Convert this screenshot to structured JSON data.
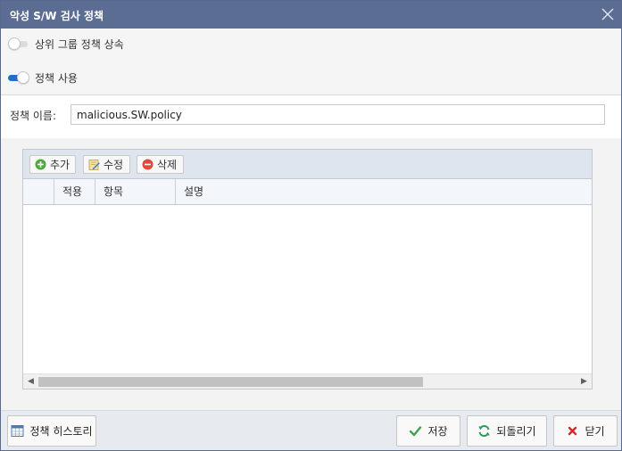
{
  "dialog": {
    "title": "악성 S/W 검사 정책"
  },
  "toggles": {
    "inherit": {
      "label": "상위 그룹 정책 상속",
      "state": "off"
    },
    "enable": {
      "label": "정책 사용",
      "state": "on"
    }
  },
  "policy_name": {
    "label": "정책 이름:",
    "value": "malicious.SW.policy"
  },
  "grid": {
    "toolbar": {
      "add_label": "추가",
      "edit_label": "수정",
      "delete_label": "삭제"
    },
    "columns": [
      "",
      "적용",
      "항목",
      "설명"
    ],
    "rows": []
  },
  "footer": {
    "history_label": "정책 히스토리",
    "save_label": "저장",
    "revert_label": "되돌리기",
    "close_label": "닫기"
  },
  "colors": {
    "titlebar": "#5c6d93",
    "toggle_on": "#1f6fc4",
    "save_check": "#3fa34d",
    "close_x": "#d9262b"
  }
}
